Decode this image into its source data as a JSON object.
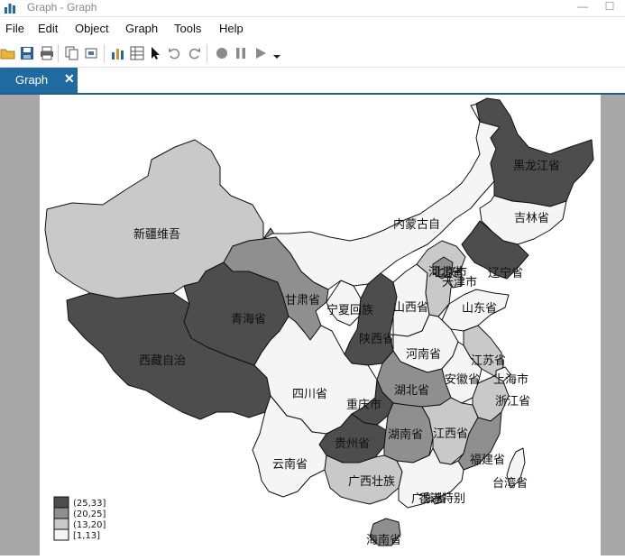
{
  "window": {
    "title": "Graph - Graph"
  },
  "menu": [
    "File",
    "Edit",
    "Object",
    "Graph",
    "Tools",
    "Help"
  ],
  "tabs": [
    {
      "label": "Graph",
      "close": "✕"
    }
  ],
  "colors": {
    "c1": "#4d4d4d",
    "c2": "#8f8f8f",
    "c3": "#c9c9c9",
    "c4": "#f5f5f5",
    "tab": "#1f6aa0",
    "gray_bg": "#a8a8a8"
  },
  "legend": [
    {
      "label": "(25,33]",
      "class": "c1"
    },
    {
      "label": "(20,25]",
      "class": "c2"
    },
    {
      "label": "(13,20]",
      "class": "c3"
    },
    {
      "label": "[1,13]",
      "class": "c4"
    }
  ],
  "regions": [
    {
      "name": "黑龙江省",
      "class": "c1"
    },
    {
      "name": "吉林省",
      "class": "c4"
    },
    {
      "name": "辽宁省",
      "class": "c1"
    },
    {
      "name": "内蒙古自",
      "class": "c4"
    },
    {
      "name": "新疆维吾",
      "class": "c3"
    },
    {
      "name": "西藏自治",
      "class": "c1"
    },
    {
      "name": "青海省",
      "class": "c1"
    },
    {
      "name": "甘肃省",
      "class": "c2"
    },
    {
      "name": "宁夏回族",
      "class": "c4"
    },
    {
      "name": "陕西省",
      "class": "c1"
    },
    {
      "name": "山西省",
      "class": "c4"
    },
    {
      "name": "河北省",
      "class": "c3"
    },
    {
      "name": "北京市",
      "class": "c2"
    },
    {
      "name": "天津市",
      "class": "c3"
    },
    {
      "name": "山东省",
      "class": "c4"
    },
    {
      "name": "河南省",
      "class": "c4"
    },
    {
      "name": "江苏省",
      "class": "c3"
    },
    {
      "name": "安徽省",
      "class": "c4"
    },
    {
      "name": "上海市",
      "class": "c4"
    },
    {
      "name": "浙江省",
      "class": "c3"
    },
    {
      "name": "湖北省",
      "class": "c2"
    },
    {
      "name": "四川省",
      "class": "c4"
    },
    {
      "name": "重庆市",
      "class": "c1"
    },
    {
      "name": "贵州省",
      "class": "c1"
    },
    {
      "name": "湖南省",
      "class": "c2"
    },
    {
      "name": "江西省",
      "class": "c3"
    },
    {
      "name": "福建省",
      "class": "c2"
    },
    {
      "name": "台湾省",
      "class": "c4"
    },
    {
      "name": "云南省",
      "class": "c4"
    },
    {
      "name": "广西壮族",
      "class": "c3"
    },
    {
      "name": "广东省",
      "class": "c4"
    },
    {
      "name": "香港特别",
      "class": "c4"
    },
    {
      "name": "海南省",
      "class": "c2"
    }
  ]
}
